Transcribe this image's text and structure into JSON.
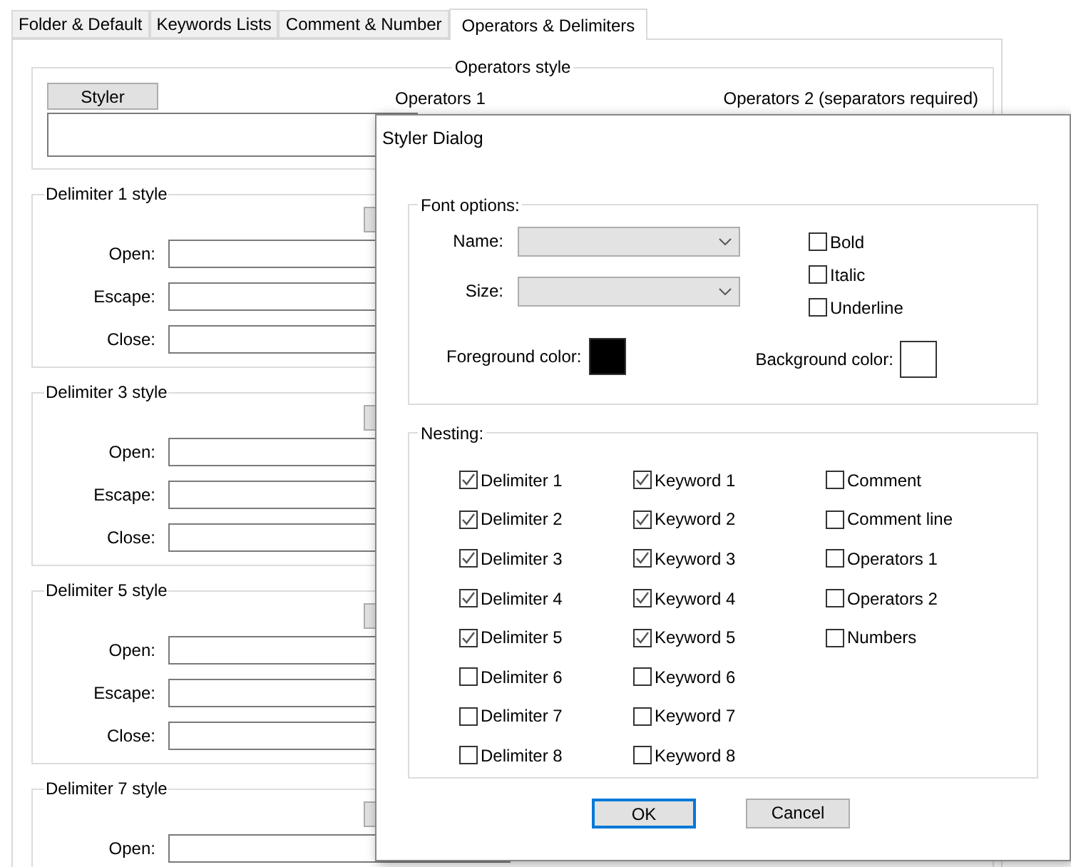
{
  "tabs": [
    {
      "label": "Folder & Default",
      "selected": false
    },
    {
      "label": "Keywords Lists",
      "selected": false
    },
    {
      "label": "Comment & Number",
      "selected": false
    },
    {
      "label": "Operators & Delimiters",
      "selected": true
    }
  ],
  "operators_style": {
    "title": "Operators style",
    "styler_button": "Styler",
    "operators_1_label": "Operators 1",
    "operators_2_label": "Operators 2 (separators required)"
  },
  "delimiter_groups": [
    {
      "title": "Delimiter 1 style",
      "fields": [
        "Open:",
        "Escape:",
        "Close:"
      ]
    },
    {
      "title": "Delimiter 3 style",
      "fields": [
        "Open:",
        "Escape:",
        "Close:"
      ]
    },
    {
      "title": "Delimiter 5 style",
      "fields": [
        "Open:",
        "Escape:",
        "Close:"
      ]
    },
    {
      "title": "Delimiter 7 style",
      "fields": [
        "Open:"
      ]
    }
  ],
  "dialog": {
    "title": "Styler Dialog",
    "font_options": {
      "title": "Font options:",
      "name_label": "Name:",
      "size_label": "Size:",
      "styles": [
        {
          "label": "Bold",
          "checked": false
        },
        {
          "label": "Italic",
          "checked": false
        },
        {
          "label": "Underline",
          "checked": false
        }
      ],
      "colors": [
        {
          "label": "Foreground color:",
          "color": "#000000"
        },
        {
          "label": "Background color:",
          "color": "#ffffff"
        }
      ]
    },
    "nesting": {
      "title": "Nesting:",
      "columns": [
        [
          {
            "label": "Delimiter 1",
            "checked": true
          },
          {
            "label": "Delimiter 2",
            "checked": true
          },
          {
            "label": "Delimiter 3",
            "checked": true
          },
          {
            "label": "Delimiter 4",
            "checked": true
          },
          {
            "label": "Delimiter 5",
            "checked": true
          },
          {
            "label": "Delimiter 6",
            "checked": false
          },
          {
            "label": "Delimiter 7",
            "checked": false
          },
          {
            "label": "Delimiter 8",
            "checked": false
          }
        ],
        [
          {
            "label": "Keyword 1",
            "checked": true
          },
          {
            "label": "Keyword 2",
            "checked": true
          },
          {
            "label": "Keyword 3",
            "checked": true
          },
          {
            "label": "Keyword 4",
            "checked": true
          },
          {
            "label": "Keyword 5",
            "checked": true
          },
          {
            "label": "Keyword 6",
            "checked": false
          },
          {
            "label": "Keyword 7",
            "checked": false
          },
          {
            "label": "Keyword 8",
            "checked": false
          }
        ],
        [
          {
            "label": "Comment",
            "checked": false
          },
          {
            "label": "Comment line",
            "checked": false
          },
          {
            "label": "Operators 1",
            "checked": false
          },
          {
            "label": "Operators 2",
            "checked": false
          },
          {
            "label": "Numbers",
            "checked": false
          }
        ]
      ]
    },
    "buttons": [
      {
        "label": "OK",
        "default": true
      },
      {
        "label": "Cancel",
        "default": false
      }
    ]
  }
}
